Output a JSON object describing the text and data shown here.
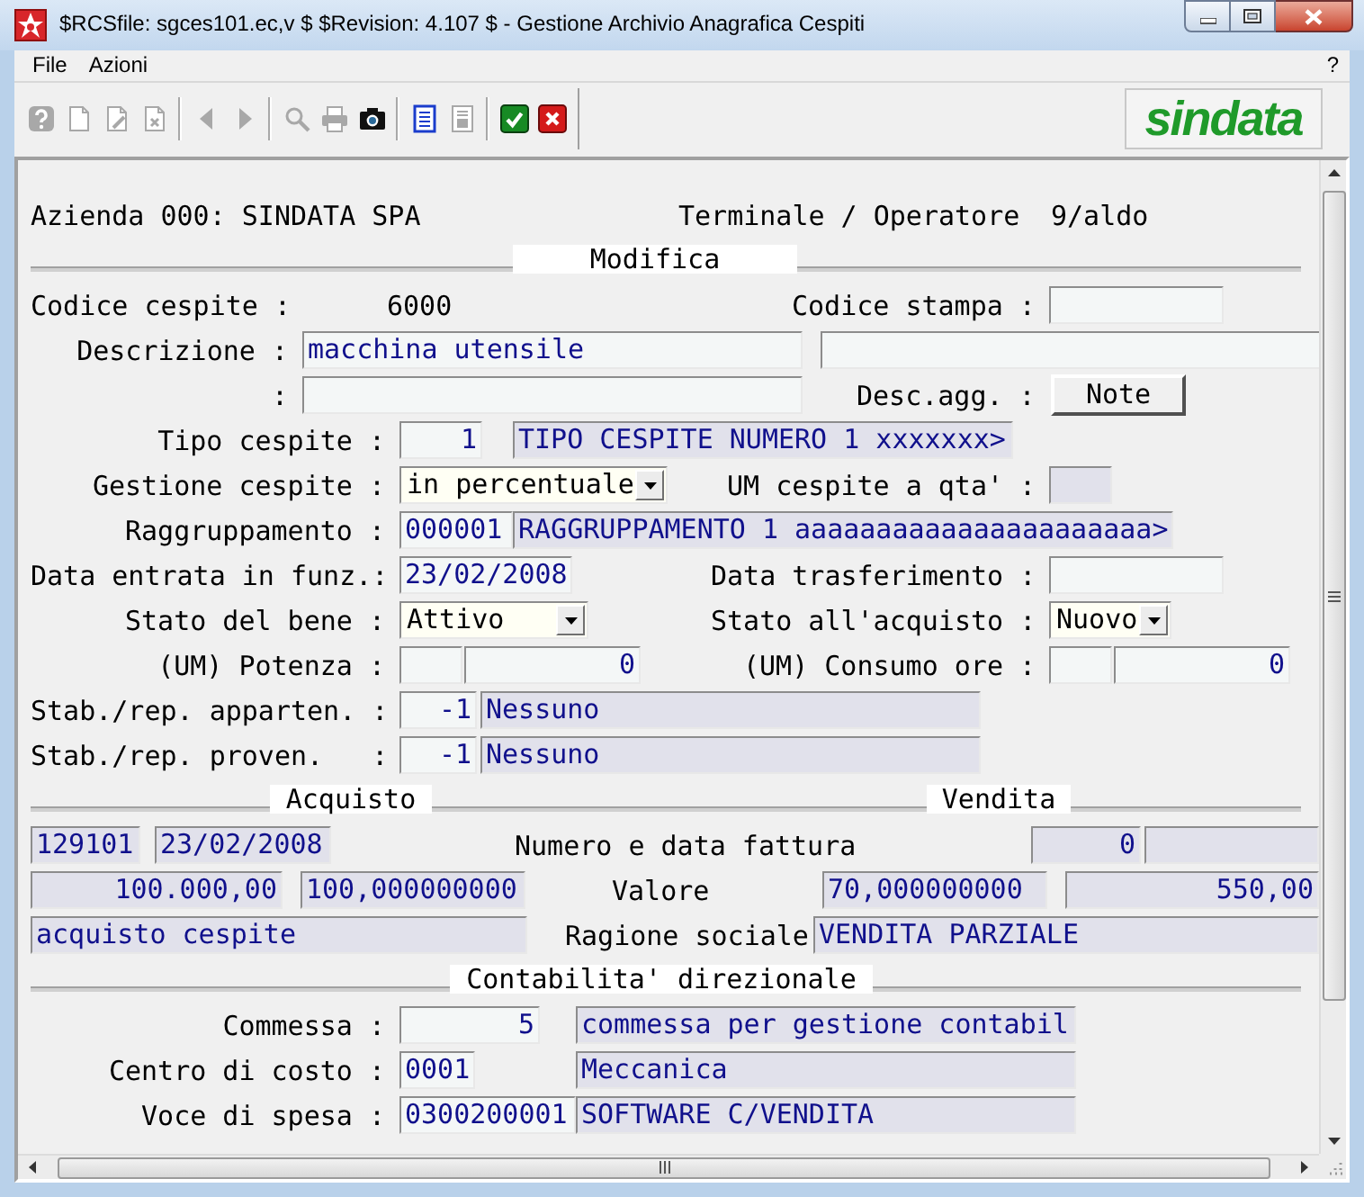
{
  "window": {
    "title": "$RCSfile: sgces101.ec,v $ $Revision: 4.107 $ - Gestione Archivio Anagrafica Cespiti"
  },
  "menu": [
    {
      "label": "File"
    },
    {
      "label": "Azioni"
    }
  ],
  "help_menu": "?",
  "toolbar": [
    [
      {
        "kind": "help",
        "disabled": true
      },
      {
        "kind": "new",
        "disabled": true
      },
      {
        "kind": "edit",
        "disabled": true
      },
      {
        "kind": "delete",
        "disabled": true
      }
    ],
    [
      {
        "kind": "previous",
        "disabled": true
      },
      {
        "kind": "next",
        "disabled": true
      }
    ],
    [
      {
        "kind": "search",
        "disabled": true
      },
      {
        "kind": "print",
        "disabled": true
      },
      {
        "kind": "camera",
        "disabled": false
      }
    ],
    [
      {
        "kind": "list",
        "disabled": false
      },
      {
        "kind": "form",
        "disabled": true
      }
    ],
    [
      {
        "kind": "confirm",
        "disabled": false
      },
      {
        "kind": "cancel",
        "disabled": false
      }
    ]
  ],
  "logo": "sindata",
  "form": {
    "rows": [
      {
        "kind": "fields",
        "items": [
          {
            "kind": "label",
            "text": "Azienda 000: SINDATA SPA"
          },
          {
            "kind": "label",
            "text": "Terminale / Operatore"
          },
          {
            "kind": "label",
            "text": "9/aldo"
          }
        ]
      },
      {
        "kind": "section",
        "titles": [
          "Modifica"
        ]
      },
      {
        "kind": "fields",
        "items": [
          {
            "kind": "label",
            "text": "Codice cespite :"
          },
          {
            "kind": "value",
            "text": "6000"
          },
          {
            "kind": "label",
            "text": "Codice stampa :"
          },
          {
            "kind": "input"
          }
        ]
      },
      {
        "kind": "fields",
        "items": [
          {
            "kind": "label",
            "text": "Descrizione :"
          },
          {
            "kind": "input",
            "value": "macchina utensile"
          },
          {
            "kind": "input"
          }
        ]
      },
      {
        "kind": "fields",
        "items": [
          {
            "kind": "label",
            "text": ":"
          },
          {
            "kind": "input"
          },
          {
            "kind": "label",
            "text": "Desc.agg. :"
          },
          {
            "kind": "button",
            "text": "Note"
          }
        ]
      },
      {
        "kind": "fields",
        "items": [
          {
            "kind": "label",
            "text": "Tipo cespite :"
          },
          {
            "kind": "input",
            "value": "1"
          },
          {
            "kind": "readonly",
            "value": "TIPO CESPITE NUMERO 1 xxxxxxx>"
          }
        ]
      },
      {
        "kind": "fields",
        "items": [
          {
            "kind": "label",
            "text": "Gestione cespite :"
          },
          {
            "kind": "select",
            "value": "in percentuale"
          },
          {
            "kind": "label",
            "text": "UM cespite a qta' :"
          },
          {
            "kind": "readonly"
          }
        ]
      },
      {
        "kind": "fields",
        "items": [
          {
            "kind": "label",
            "text": "Raggruppamento :"
          },
          {
            "kind": "input",
            "value": "000001"
          },
          {
            "kind": "readonly",
            "value": "RAGGRUPPAMENTO 1 aaaaaaaaaaaaaaaaaaaaaa>"
          }
        ]
      },
      {
        "kind": "fields",
        "items": [
          {
            "kind": "label",
            "text": "Data entrata in funz.:"
          },
          {
            "kind": "input",
            "value": "23/02/2008"
          },
          {
            "kind": "label",
            "text": "Data trasferimento :"
          },
          {
            "kind": "input"
          }
        ]
      },
      {
        "kind": "fields",
        "items": [
          {
            "kind": "label",
            "text": "Stato del bene :"
          },
          {
            "kind": "select",
            "value": "Attivo"
          },
          {
            "kind": "label",
            "text": "Stato all'acquisto :"
          },
          {
            "kind": "select",
            "value": "Nuovo"
          }
        ]
      },
      {
        "kind": "fields",
        "items": [
          {
            "kind": "label",
            "text": "(UM) Potenza :"
          },
          {
            "kind": "input"
          },
          {
            "kind": "input",
            "value": "0"
          },
          {
            "kind": "label",
            "text": "(UM) Consumo ore :"
          },
          {
            "kind": "input"
          },
          {
            "kind": "input",
            "value": "0"
          }
        ]
      },
      {
        "kind": "fields",
        "items": [
          {
            "kind": "label",
            "text": "Stab./rep. apparten. :"
          },
          {
            "kind": "input",
            "value": "-1"
          },
          {
            "kind": "readonly",
            "value": "Nessuno"
          }
        ]
      },
      {
        "kind": "fields",
        "items": [
          {
            "kind": "label",
            "text": "Stab./rep. proven.   :"
          },
          {
            "kind": "input",
            "value": "-1"
          },
          {
            "kind": "readonly",
            "value": "Nessuno"
          }
        ]
      },
      {
        "kind": "section",
        "titles": [
          "Acquisto",
          "Vendita"
        ]
      },
      {
        "kind": "fields",
        "items": [
          {
            "kind": "readonly",
            "value": "129101"
          },
          {
            "kind": "readonly",
            "value": "23/02/2008"
          },
          {
            "kind": "label",
            "text": "Numero e data fattura"
          },
          {
            "kind": "readonly",
            "value": "0"
          },
          {
            "kind": "readonly"
          }
        ]
      },
      {
        "kind": "fields",
        "items": [
          {
            "kind": "readonly",
            "value": "100.000,00"
          },
          {
            "kind": "readonly",
            "value": "100,000000000"
          },
          {
            "kind": "label",
            "text": "Valore"
          },
          {
            "kind": "readonly",
            "value": "70,000000000"
          },
          {
            "kind": "readonly",
            "value": "550,00"
          }
        ]
      },
      {
        "kind": "fields",
        "items": [
          {
            "kind": "readonly",
            "value": "acquisto cespite"
          },
          {
            "kind": "label",
            "text": "Ragione sociale"
          },
          {
            "kind": "readonly",
            "value": "VENDITA PARZIALE"
          }
        ]
      },
      {
        "kind": "section",
        "titles": [
          "Contabilita' direzionale"
        ]
      },
      {
        "kind": "fields",
        "items": [
          {
            "kind": "label",
            "text": "Commessa :"
          },
          {
            "kind": "input",
            "value": "5"
          },
          {
            "kind": "readonly",
            "value": "commessa per gestione contabil"
          }
        ]
      },
      {
        "kind": "fields",
        "items": [
          {
            "kind": "label",
            "text": "Centro di costo :"
          },
          {
            "kind": "input",
            "value": "0001"
          },
          {
            "kind": "readonly",
            "value": "Meccanica"
          }
        ]
      },
      {
        "kind": "fields",
        "items": [
          {
            "kind": "label",
            "text": "Voce di spesa :"
          },
          {
            "kind": "input",
            "value": "0300200001"
          },
          {
            "kind": "readonly",
            "value": "SOFTWARE C/VENDITA"
          }
        ]
      }
    ]
  }
}
